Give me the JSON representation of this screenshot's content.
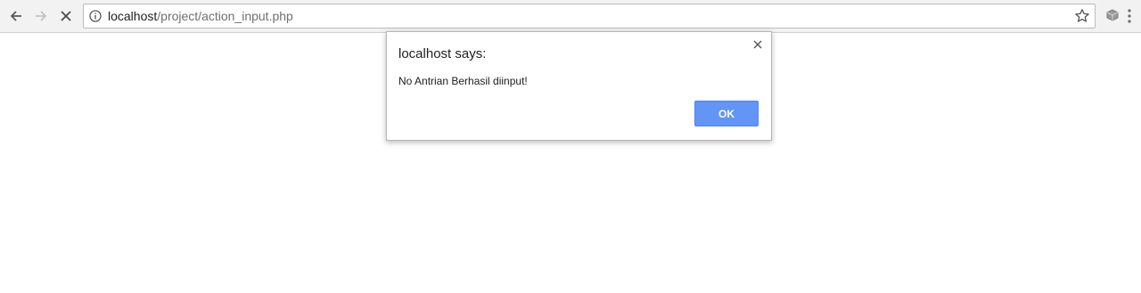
{
  "browser": {
    "url_host": "localhost",
    "url_path": "/project/action_input.php",
    "icons": {
      "back": "back-arrow-icon",
      "forward": "forward-arrow-icon",
      "stop": "stop-loading-icon",
      "info": "info-icon",
      "bookmark": "star-icon",
      "extension": "extension-icon",
      "menu": "menu-icon"
    }
  },
  "dialog": {
    "title": "localhost says:",
    "message": "No Antrian Berhasil diinput!",
    "ok_label": "OK"
  },
  "colors": {
    "accent": "#6295f5",
    "toolbar": "#f2f2f2"
  }
}
